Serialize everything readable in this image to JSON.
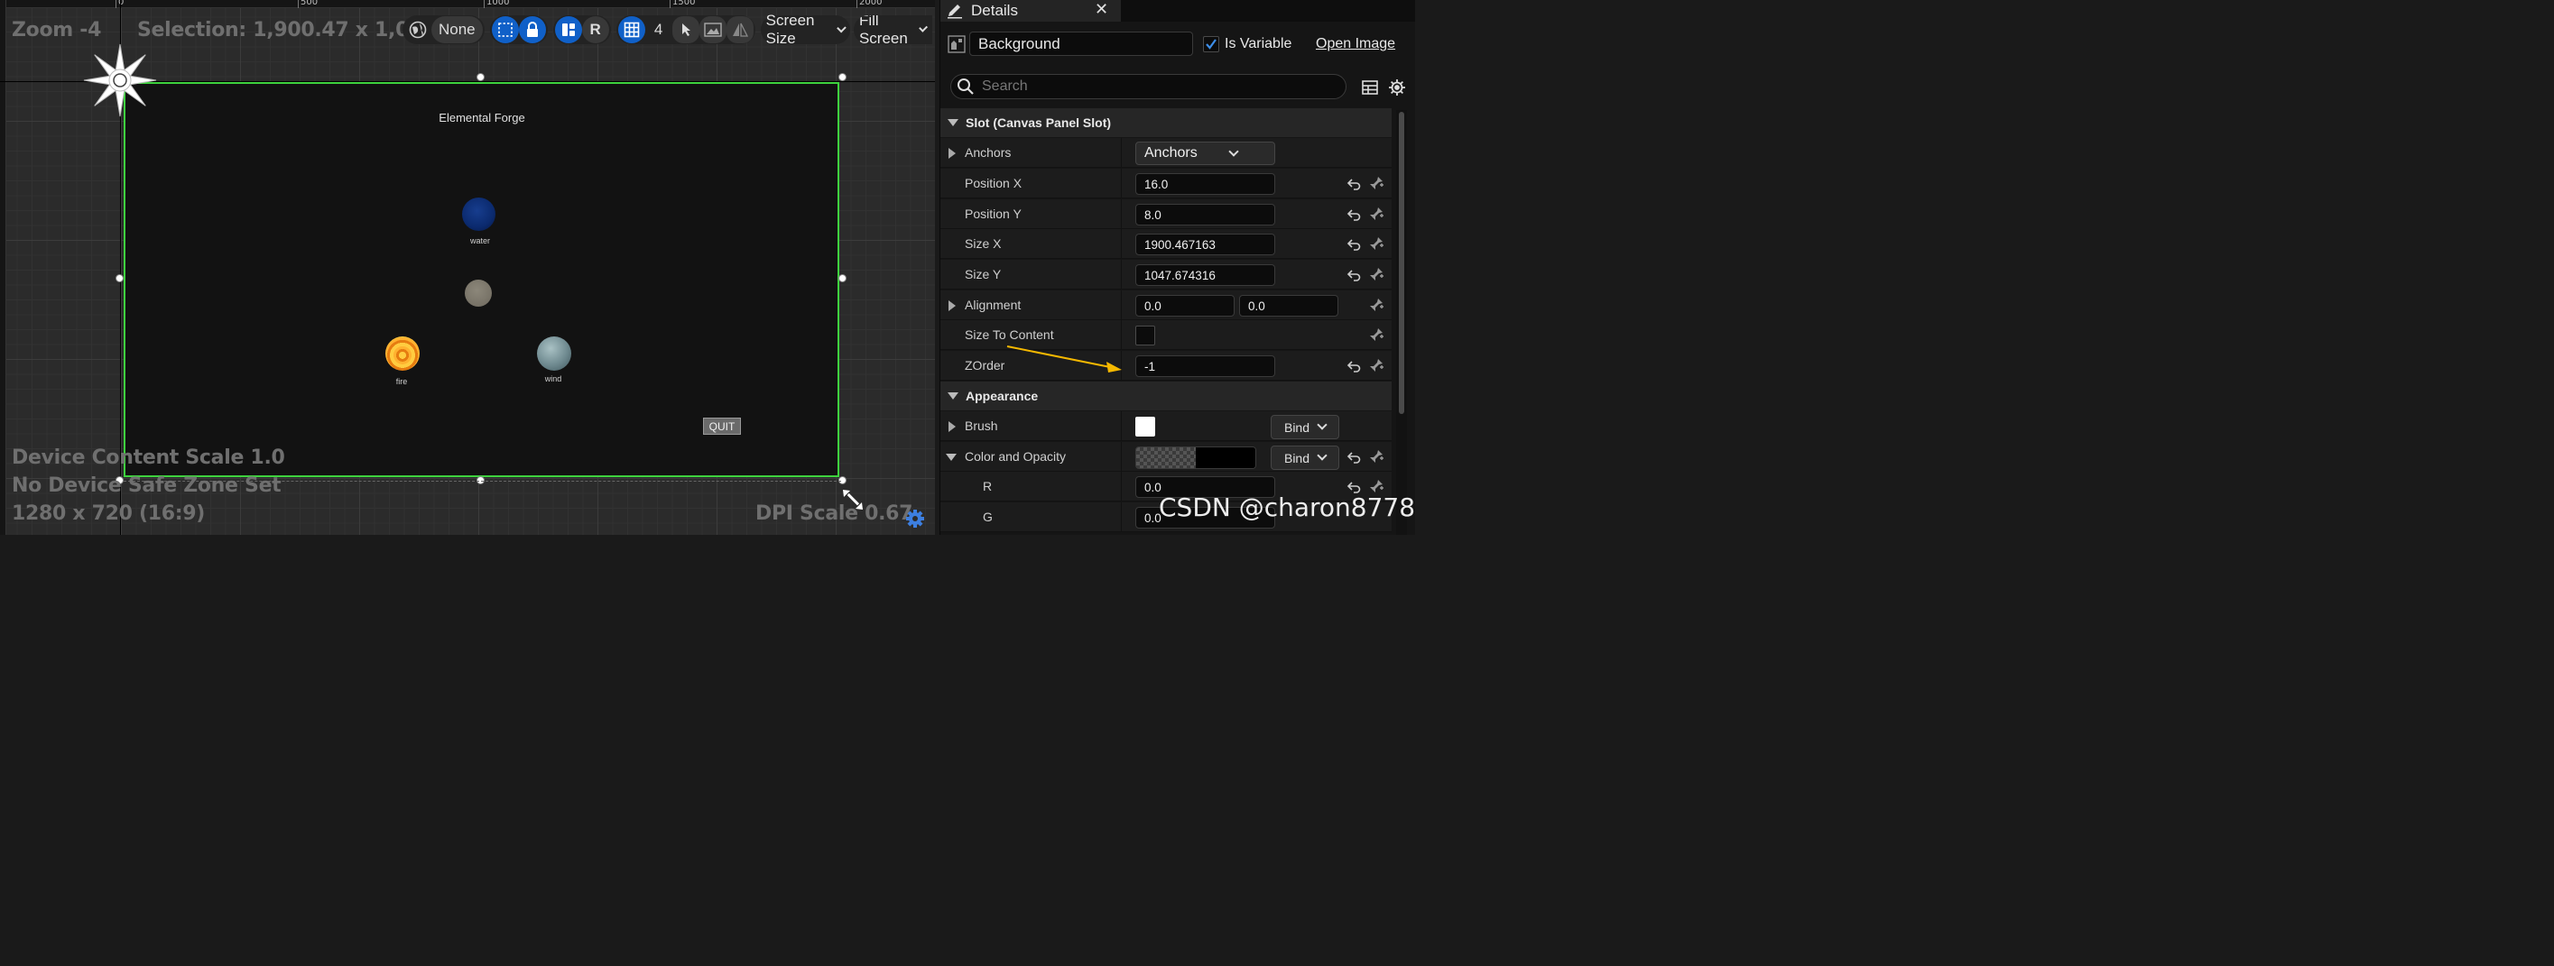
{
  "viewport": {
    "zoom": "Zoom -4",
    "selection": "Selection: 1,900.47 x 1,047.67",
    "ruler_ticks": [
      "0",
      "500",
      "1000",
      "1500",
      "2000"
    ],
    "toolbar": {
      "localization": "None",
      "grid_snap": "4",
      "screen_size": "Screen Size",
      "fill_screen": "Fill Screen",
      "r_label": "R"
    },
    "device_scale": "Device Content Scale 1.0",
    "safe_zone": "No Device Safe Zone Set",
    "resolution": "1280 x 720 (16:9)",
    "dpi_scale": "DPI Scale 0.67"
  },
  "game": {
    "title": "Elemental Forge",
    "orbs": [
      {
        "label": "water",
        "color": "#0b2a6e"
      },
      {
        "label": "",
        "color": "#7b766a"
      },
      {
        "label": "fire",
        "color": "#f39a1a"
      },
      {
        "label": "wind",
        "color": "#6f8a90"
      }
    ],
    "quit_label": "QUIT"
  },
  "details": {
    "tab_title": "Details",
    "widget_name": "Background",
    "is_variable_label": "Is Variable",
    "is_variable_checked": true,
    "open_image_label": "Open Image",
    "search_placeholder": "Search",
    "sections": {
      "slot": "Slot (Canvas Panel Slot)",
      "appearance": "Appearance"
    },
    "props": {
      "anchors": {
        "name": "Anchors",
        "value": "Anchors"
      },
      "position_x": {
        "name": "Position X",
        "value": "16.0"
      },
      "position_y": {
        "name": "Position Y",
        "value": "8.0"
      },
      "size_x": {
        "name": "Size X",
        "value": "1900.467163"
      },
      "size_y": {
        "name": "Size Y",
        "value": "1047.674316"
      },
      "alignment": {
        "name": "Alignment",
        "value_x": "0.0",
        "value_y": "0.0"
      },
      "size_to_content": {
        "name": "Size To Content",
        "checked": false
      },
      "zorder": {
        "name": "ZOrder",
        "value": "-1"
      },
      "brush": {
        "name": "Brush",
        "bind": "Bind"
      },
      "color_opacity": {
        "name": "Color and Opacity",
        "bind": "Bind"
      },
      "r": {
        "name": "R",
        "value": "0.0"
      },
      "g": {
        "name": "G",
        "value": "0.0"
      }
    },
    "arrow_color": "#f5b800"
  },
  "watermark": "CSDN @charon8778"
}
